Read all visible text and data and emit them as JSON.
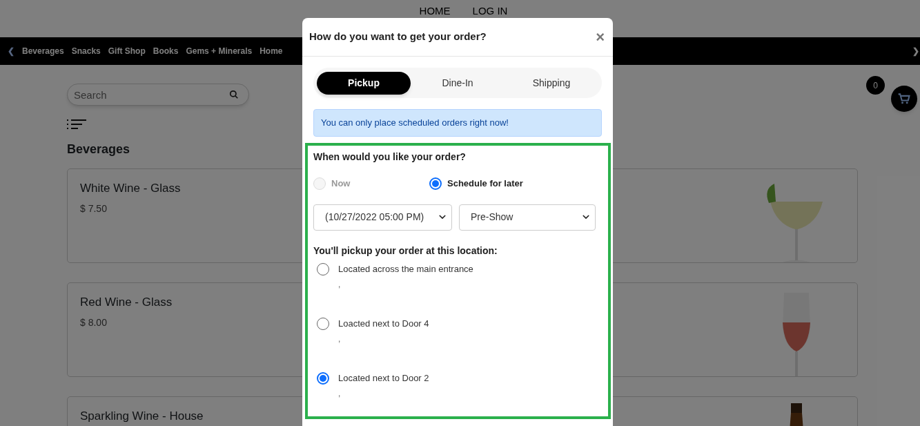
{
  "top_links": [
    {
      "label": "HOME"
    },
    {
      "label": "LOG IN"
    }
  ],
  "category_nav": {
    "prev": "❮",
    "next": "❯",
    "items": [
      {
        "label": "Beverages"
      },
      {
        "label": "Snacks"
      },
      {
        "label": "Gift Shop"
      },
      {
        "label": "Books"
      },
      {
        "label": "Gems + Minerals"
      },
      {
        "label": "Home"
      }
    ]
  },
  "search": {
    "placeholder": "Search"
  },
  "section_title": "Beverages",
  "products": [
    {
      "name": "White Wine - Glass",
      "price": "$ 7.50",
      "kind": "cocktail"
    },
    {
      "name": "Red Wine - Glass",
      "price": "$ 8.00",
      "kind": "wine"
    },
    {
      "name": "Sparkling Wine - House",
      "kind": "bottle"
    }
  ],
  "cart": {
    "count": "0"
  },
  "modal": {
    "title": "How do you want to get your order?",
    "close": "×",
    "tabs": [
      {
        "label": "Pickup",
        "selected": true
      },
      {
        "label": "Dine-In",
        "selected": false
      },
      {
        "label": "Shipping",
        "selected": false
      }
    ],
    "alert": "You can only place scheduled orders right now!",
    "when": {
      "question": "When would you like your order?",
      "options": [
        {
          "label": "Now",
          "selected": false,
          "disabled": true
        },
        {
          "label": "Schedule for later",
          "selected": true,
          "disabled": false
        }
      ]
    },
    "selects": [
      {
        "value": "(10/27/2022 05:00 PM)"
      },
      {
        "value": "Pre-Show"
      }
    ],
    "location": {
      "heading": "You'll pickup your order at this location:",
      "options": [
        {
          "label": "Located across the main entrance",
          "sublabel": ",",
          "selected": false
        },
        {
          "label": "Loacted next to Door 4",
          "sublabel": ",",
          "selected": false
        },
        {
          "label": "Located next to Door 2",
          "sublabel": ",",
          "selected": true
        }
      ]
    }
  }
}
